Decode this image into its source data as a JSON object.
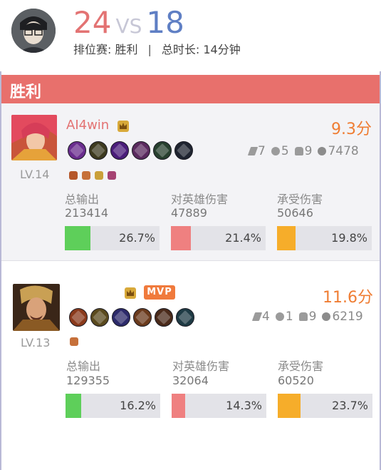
{
  "header": {
    "score_win": "24",
    "vs": "VS",
    "score_lose": "18",
    "match_type": "排位赛: 胜利",
    "separator": "|",
    "duration": "总时长: 14分钟"
  },
  "banner": {
    "label": "胜利"
  },
  "stat_labels": {
    "damage": "总输出",
    "hero_damage": "对英雄伤害",
    "taken": "承受伤害"
  },
  "colors": {
    "damage": "#5ecf5a",
    "hero_damage": "#ef8080",
    "taken": "#f6ad2a",
    "rating": "#ef7d33",
    "win": "#e37373",
    "lose": "#5f7fc4"
  },
  "players": [
    {
      "name": "AI4win",
      "level": "LV.14",
      "rating": "9.3分",
      "mvp": "",
      "kills": "7",
      "deaths": "5",
      "assists": "9",
      "gold": "7478",
      "items": [
        "item-1-icon",
        "item-2-icon",
        "item-3-icon",
        "item-4-icon",
        "item-5-icon",
        "item-6-icon"
      ],
      "runes": 4,
      "damage": {
        "value": "213414",
        "pct": "26.7%",
        "fraction": 0.267
      },
      "hero_damage": {
        "value": "47889",
        "pct": "21.4%",
        "fraction": 0.214
      },
      "taken": {
        "value": "50646",
        "pct": "19.8%",
        "fraction": 0.198
      }
    },
    {
      "name": "",
      "level": "LV.13",
      "rating": "11.6分",
      "mvp": "MVP",
      "kills": "4",
      "deaths": "1",
      "assists": "9",
      "gold": "6219",
      "items": [
        "item-1-icon",
        "item-2-icon",
        "item-3-icon",
        "item-4-icon",
        "item-5-icon",
        "item-6-icon"
      ],
      "runes": 1,
      "damage": {
        "value": "129355",
        "pct": "16.2%",
        "fraction": 0.162
      },
      "hero_damage": {
        "value": "32064",
        "pct": "14.3%",
        "fraction": 0.143
      },
      "taken": {
        "value": "60520",
        "pct": "23.7%",
        "fraction": 0.237
      }
    }
  ]
}
